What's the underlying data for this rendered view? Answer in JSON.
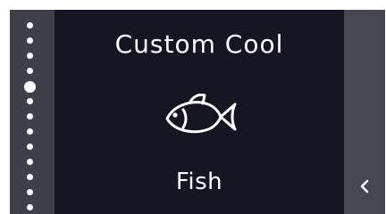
{
  "screen": {
    "title": "Custom Cool",
    "mode_label": "Fish",
    "mode_icon": "fish-icon",
    "back_icon": "chevron-left-icon"
  },
  "page_indicator": {
    "total_pages": 13,
    "active_index": 4
  },
  "colors": {
    "main_background": "#161622",
    "bezel": "#3f3f49",
    "side_panel": "#474752",
    "foreground": "#ffffff"
  }
}
